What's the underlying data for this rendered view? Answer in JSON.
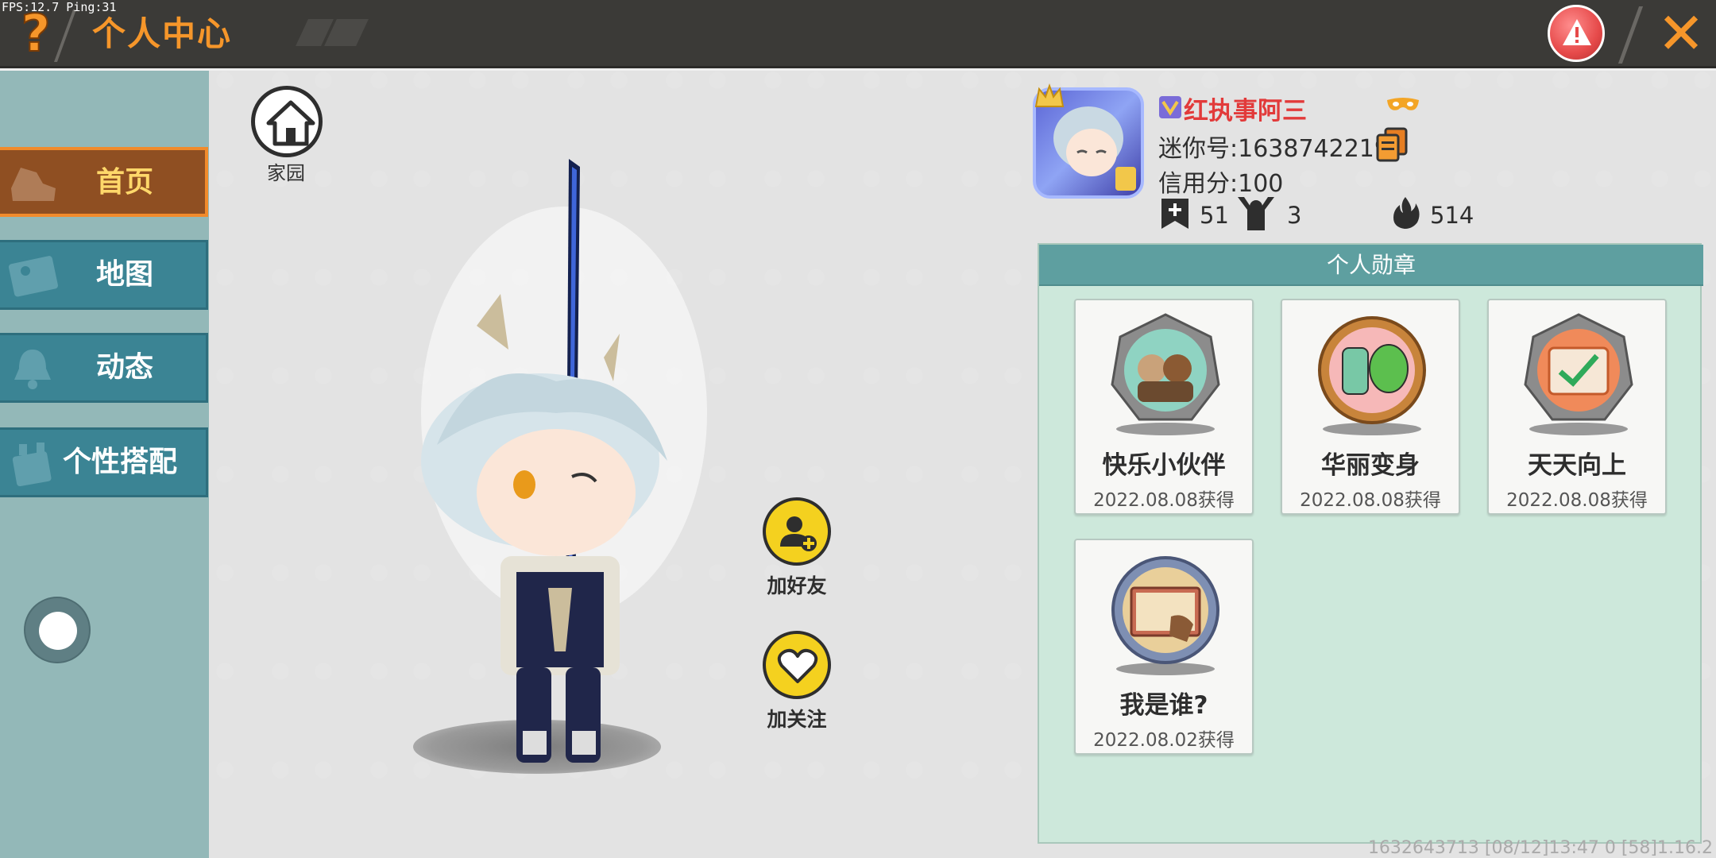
{
  "debug": {
    "fps_text": "FPS:12.7 Ping:31"
  },
  "header": {
    "title": "个人中心",
    "help_icon": "?",
    "close_icon": "✕",
    "accent": "#f6962a",
    "bar_color": "#3b3a37"
  },
  "sidebar": {
    "items": [
      {
        "label": "首页",
        "icon": "shoe-icon",
        "active": true
      },
      {
        "label": "地图",
        "icon": "picture-icon",
        "active": false
      },
      {
        "label": "动态",
        "icon": "bell-icon",
        "active": false
      },
      {
        "label": "个性搭配",
        "icon": "character-icon",
        "active": false
      }
    ]
  },
  "stage": {
    "home_label": "家园",
    "add_friend_label": "加好友",
    "follow_label": "加关注"
  },
  "profile": {
    "nickname": "红执事阿三",
    "mini_id": "迷你号:1638742219",
    "credit": "信用分:100",
    "stats": [
      {
        "icon": "bookmark-plus-icon",
        "value": "51"
      },
      {
        "icon": "fans-icon",
        "value": "3"
      },
      {
        "icon": "flame-icon",
        "value": "514"
      }
    ]
  },
  "medals": {
    "title": "个人勋章",
    "items": [
      {
        "name": "快乐小伙伴",
        "date": "2022.08.08获得"
      },
      {
        "name": "华丽变身",
        "date": "2022.08.08获得"
      },
      {
        "name": "天天向上",
        "date": "2022.08.08获得"
      },
      {
        "name": "我是谁?",
        "date": "2022.08.02获得"
      }
    ]
  },
  "footer": {
    "info": "1632643713   [08/12]13:47 0  [58]1.16.2"
  }
}
